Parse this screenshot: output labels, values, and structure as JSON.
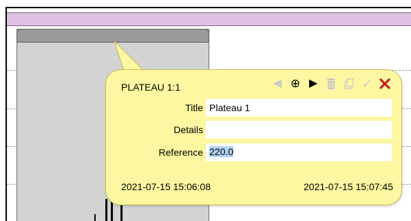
{
  "popup": {
    "title": "PLATEAU 1:1",
    "toolbar": [
      {
        "name": "previous-icon",
        "glyph": "◀",
        "enabled": false
      },
      {
        "name": "center-icon",
        "glyph": "⊕",
        "enabled": true
      },
      {
        "name": "next-icon",
        "glyph": "▶",
        "enabled": true
      },
      {
        "name": "trash-icon",
        "glyph": "trash",
        "enabled": false
      },
      {
        "name": "copy-icon",
        "glyph": "copy",
        "enabled": false
      },
      {
        "name": "check-icon",
        "glyph": "✓",
        "enabled": false
      },
      {
        "name": "close-icon",
        "glyph": "✕",
        "enabled": true
      }
    ],
    "fields": {
      "title": {
        "label": "Title",
        "value": "Plateau 1"
      },
      "details": {
        "label": "Details",
        "value": ""
      },
      "reference": {
        "label": "Reference",
        "value": "220.0"
      }
    },
    "start_time": "2021-07-15 15:06:08",
    "end_time": "2021-07-15 15:07:45"
  },
  "colors": {
    "popup_bg": "#fdf7a1",
    "popup_border": "#c7bd4f",
    "band": "#e1c2e5",
    "plateau_fill": "#d3d3d3",
    "plateau_handle": "#9a9a9a",
    "close_red": "#c0211c",
    "disabled_gray": "#c8c8c8",
    "selection": "#b2d3f5"
  }
}
